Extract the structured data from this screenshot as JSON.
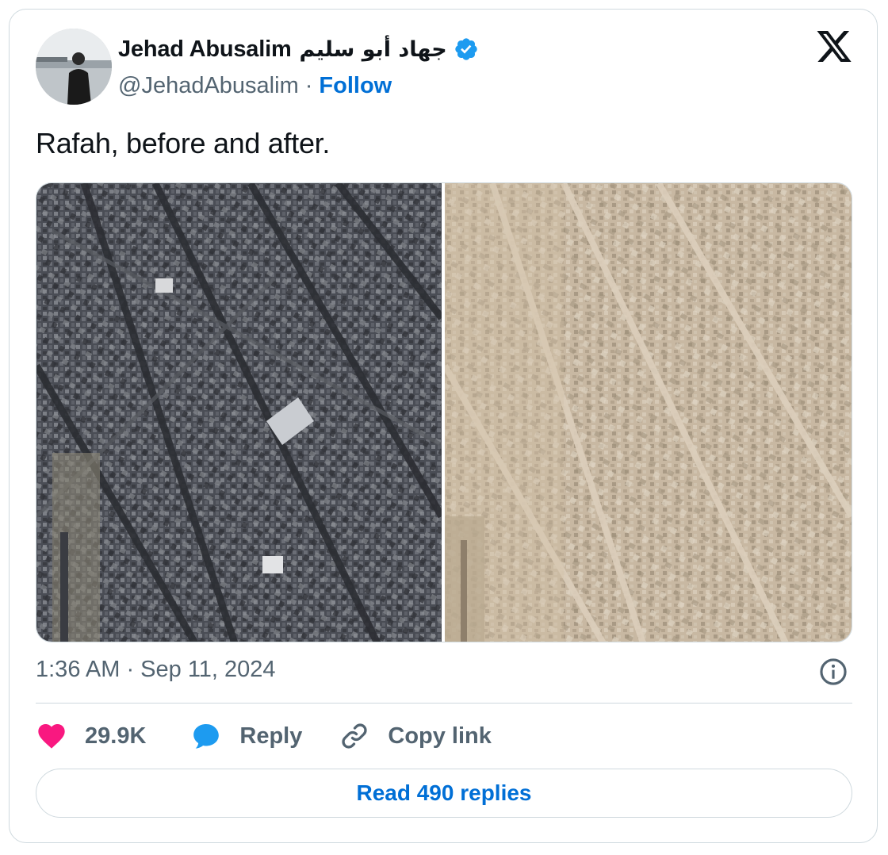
{
  "author": {
    "name": "Jehad Abusalim",
    "name_arabic": "جهاد أبو سليم",
    "handle": "@JehadAbusalim",
    "follow_label": "Follow",
    "separator": "·",
    "verified": true,
    "verified_color": "#1d9bf0"
  },
  "tweet": {
    "text": "Rafah, before and after.",
    "timestamp": "1:36 AM · Sep 11, 2024"
  },
  "media": {
    "left_image": "satellite-before",
    "right_image": "satellite-after"
  },
  "actions": {
    "likes": "29.9K",
    "reply_label": "Reply",
    "copy_link_label": "Copy link",
    "like_color": "#f91880",
    "reply_color": "#1d9bf0"
  },
  "read_replies_label": "Read 490 replies",
  "icons": [
    "x-logo-icon",
    "verified-badge-icon",
    "info-icon",
    "heart-icon",
    "reply-bubble-icon",
    "link-icon"
  ]
}
